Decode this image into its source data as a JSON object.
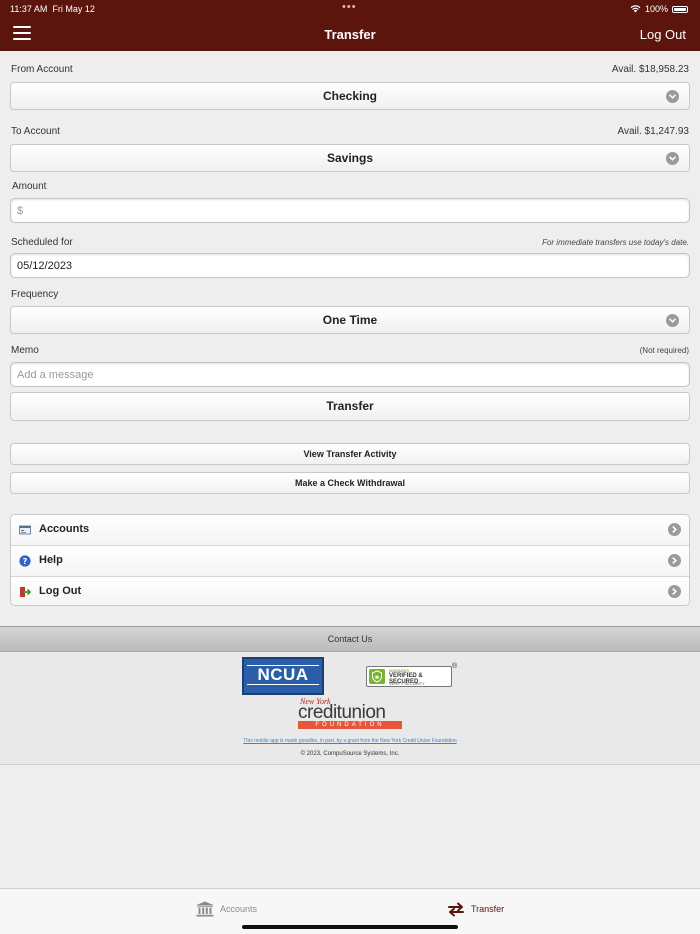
{
  "status_bar": {
    "time": "11:37 AM",
    "date": "Fri May 12",
    "dots": "•••",
    "battery": "100%"
  },
  "header": {
    "title": "Transfer",
    "logout_label": "Log Out",
    "menu_icon": "hamburger-icon"
  },
  "form": {
    "from_account": {
      "label": "From Account",
      "available": "Avail. $18,958.23",
      "selected": "Checking"
    },
    "to_account": {
      "label": "To Account",
      "available": "Avail. $1,247.93",
      "selected": "Savings"
    },
    "amount": {
      "label": "Amount",
      "value": "",
      "placeholder": "$"
    },
    "scheduled": {
      "label": "Scheduled for",
      "note": "For immediate transfers use today's date.",
      "value": "05/12/2023"
    },
    "frequency": {
      "label": "Frequency",
      "selected": "One Time"
    },
    "memo": {
      "label": "Memo",
      "note": "(Not required)",
      "value": "",
      "placeholder": "Add a message"
    },
    "submit_label": "Transfer"
  },
  "actions": {
    "view_activity": "View Transfer Activity",
    "check_withdrawal": "Make a Check Withdrawal"
  },
  "menu": {
    "items": [
      {
        "label": "Accounts",
        "icon": "accounts-icon"
      },
      {
        "label": "Help",
        "icon": "help-icon"
      },
      {
        "label": "Log Out",
        "icon": "logout-icon"
      }
    ]
  },
  "footer": {
    "contact_label": "Contact Us",
    "ncua_logo": "NCUA",
    "godaddy_badge": {
      "brand": "GODADDY",
      "line1": "VERIFIED & SECURED",
      "line2": "VERIFY SECURITY",
      "reg": "®"
    },
    "nycu_logo": {
      "top": "New York",
      "main": "creditunion",
      "bottom": "FOUNDATION"
    },
    "grant_text": "This mobile app is made possible, in part, by a grant from the New York Credit Union Foundation",
    "copyright": "© 2023, CompuSource Systems, Inc."
  },
  "tab_bar": {
    "tabs": [
      {
        "label": "Accounts",
        "icon": "bank-icon",
        "active": false
      },
      {
        "label": "Transfer",
        "icon": "transfer-arrows-icon",
        "active": true
      }
    ]
  },
  "colors": {
    "brand": "#5c150d",
    "tab_inactive": "#8a8a8a"
  }
}
